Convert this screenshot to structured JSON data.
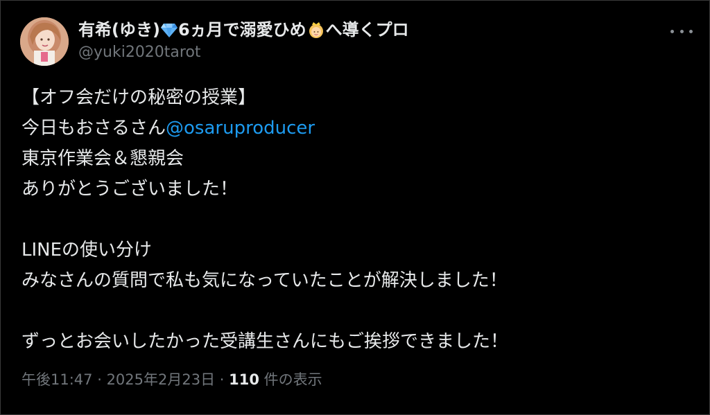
{
  "tweet": {
    "author": {
      "name_part1": "有希(ゆき)",
      "gem_icon": "gem-icon",
      "name_part2": "6ヵ月で溺愛ひめ",
      "princess_icon": "princess-icon",
      "name_part3": "へ導くプロ",
      "handle": "@yuki2020tarot"
    },
    "lines": {
      "l1": "【オフ会だけの秘密の授業】",
      "l2_text": "今日もおさるさん",
      "l2_mention": "@osaruproducer",
      "l3": "東京作業会＆懇親会",
      "l4": "ありがとうございました！",
      "l5": "LINEの使い分け",
      "l6": "みなさんの質問で私も気になっていたことが解決しました！",
      "l7": "ずっとお会いしたかった受講生さんにもご挨拶できました！"
    },
    "meta": {
      "time": "午後11:47",
      "sep1": " · ",
      "date": "2025年2月23日",
      "sep2": " · ",
      "views": "110",
      "views_label": " 件の表示"
    }
  },
  "colors": {
    "background": "#000000",
    "text": "#e7e9ea",
    "muted": "#71767b",
    "link": "#1d9bf0"
  }
}
